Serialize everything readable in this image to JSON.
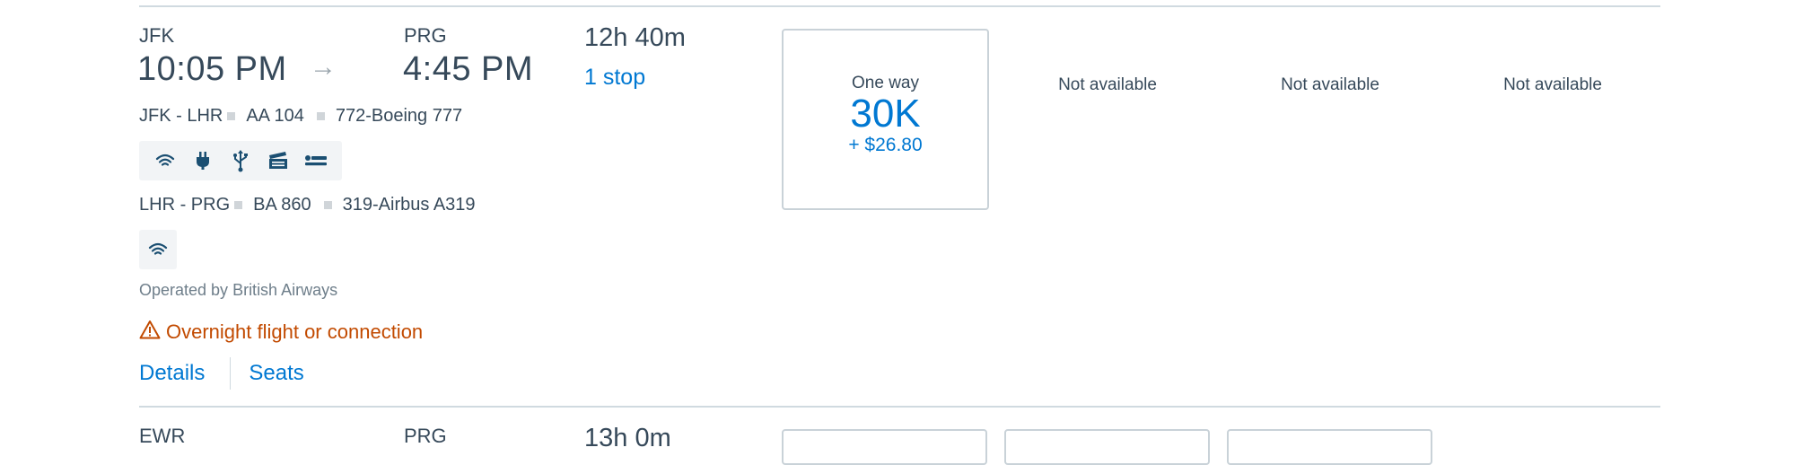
{
  "flight1": {
    "origin": "JFK",
    "depart_time": "10:05 PM",
    "arrow": "→",
    "destination": "PRG",
    "arrive_time": "4:45 PM",
    "duration": "12h 40m",
    "stops": "1 stop",
    "segments": [
      {
        "route": "JFK - LHR",
        "flight": "AA 104",
        "aircraft": "772-Boeing 777",
        "amenities": [
          "wifi-icon",
          "power-plug-icon",
          "usb-icon",
          "entertainment-icon",
          "lie-flat-seat-icon"
        ]
      },
      {
        "route": "LHR - PRG",
        "flight": "BA 860",
        "aircraft": "319-Airbus A319",
        "amenities": [
          "wifi-icon"
        ]
      }
    ],
    "operated_by": "Operated by British Airways",
    "warning": "Overnight flight or connection",
    "details_link": "Details",
    "seats_link": "Seats",
    "fares": {
      "card": {
        "label": "One way",
        "miles": "30K",
        "tax": "+ $26.80"
      },
      "col2": "Not available",
      "col3": "Not available",
      "col4": "Not available"
    }
  },
  "flight2": {
    "origin": "EWR",
    "destination": "PRG",
    "duration": "13h 0m"
  },
  "colors": {
    "link": "#0078d2",
    "warning": "#c24a00",
    "text": "#36495a",
    "divider": "#d0dae0"
  }
}
